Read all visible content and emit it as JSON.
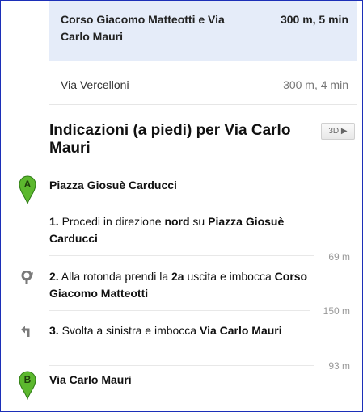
{
  "routes": [
    {
      "name": "Corso Giacomo Matteotti e Via Carlo Mauri",
      "meta": "300 m, 5 min",
      "selected": true
    },
    {
      "name": "Via Vercelloni",
      "meta": "300 m, 4 min",
      "selected": false
    }
  ],
  "directions": {
    "title": "Indicazioni (a piedi) per Via Carlo Mauri",
    "view_3d_label": "3D ▶",
    "origin": {
      "marker": "A",
      "name": "Piazza Giosuè Carducci",
      "marker_color": "#5cb82e"
    },
    "steps": [
      {
        "num": "1.",
        "parts": [
          {
            "t": " Procedi in direzione ",
            "b": false
          },
          {
            "t": "nord",
            "b": true
          },
          {
            "t": " su ",
            "b": false
          },
          {
            "t": "Piazza Giosuè Carducci",
            "b": true
          }
        ],
        "icon": "",
        "distance": "69 m"
      },
      {
        "num": "2.",
        "parts": [
          {
            "t": " Alla rotonda prendi la ",
            "b": false
          },
          {
            "t": "2a",
            "b": true
          },
          {
            "t": " uscita e imbocca ",
            "b": false
          },
          {
            "t": "Corso Giacomo Matteotti",
            "b": true
          }
        ],
        "icon": "roundabout-icon",
        "distance": "150 m"
      },
      {
        "num": "3.",
        "parts": [
          {
            "t": " Svolta a sinistra e imbocca ",
            "b": false
          },
          {
            "t": "Via Carlo Mauri",
            "b": true
          }
        ],
        "icon": "turn-left-icon",
        "distance": "93 m"
      }
    ],
    "destination": {
      "marker": "B",
      "name": "Via Carlo Mauri",
      "marker_color": "#5cb82e"
    }
  }
}
